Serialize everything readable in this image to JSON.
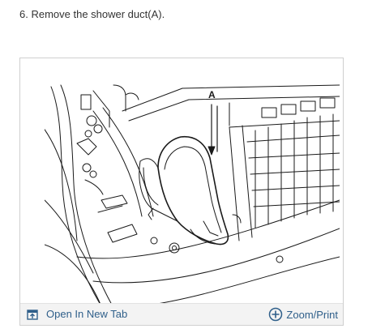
{
  "step": {
    "text": "6. Remove the shower duct(A)."
  },
  "figure": {
    "callout_label": "A",
    "footer": {
      "open_tab_label": "Open In New Tab",
      "open_tab_icon": "open-in-new-tab-icon",
      "zoom_label": "Zoom/Print",
      "zoom_icon": "plus-circle-icon"
    }
  },
  "colors": {
    "link": "#2f5f8a",
    "footer_bg": "#f3f3f3",
    "border": "#cfcfcf"
  }
}
